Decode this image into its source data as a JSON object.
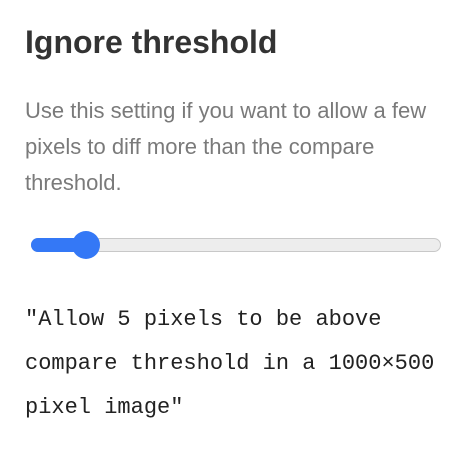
{
  "setting": {
    "title": "Ignore threshold",
    "description": "Use this setting if you want to allow a few pixels to diff more than the compare threshold."
  },
  "slider": {
    "value_fraction": 0.135,
    "accent_color": "#3478f6"
  },
  "result": {
    "text": "\"Allow 5 pixels to be above compare threshold in a 1000×500 pixel image\""
  }
}
